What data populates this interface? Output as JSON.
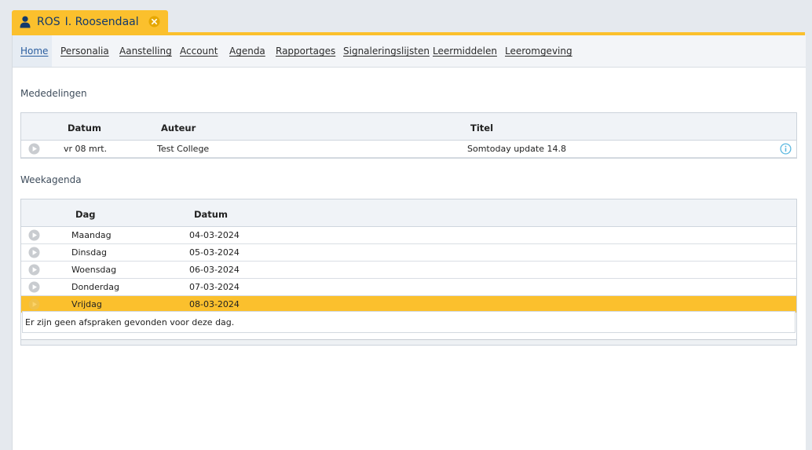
{
  "tab": {
    "code": "ROS",
    "name": "I. Roosendaal",
    "icon": "user-icon",
    "close_icon": "close-circle-icon"
  },
  "menu": [
    {
      "label": "Home",
      "active": true
    },
    {
      "label": "Personalia"
    },
    {
      "label": "Aanstelling"
    },
    {
      "label": "Account"
    },
    {
      "label": "Agenda"
    },
    {
      "label": "Rapportages"
    },
    {
      "label": "Signaleringslijsten"
    },
    {
      "label": "Leermiddelen"
    },
    {
      "label": "Leeromgeving"
    }
  ],
  "mededelingen": {
    "title": "Mededelingen",
    "headers": {
      "datum": "Datum",
      "auteur": "Auteur",
      "titel": "Titel"
    },
    "rows": [
      {
        "datum": "vr 08 mrt.",
        "auteur": "Test College",
        "titel": "Somtoday update 14.8"
      }
    ]
  },
  "weekagenda": {
    "title": "Weekagenda",
    "headers": {
      "dag": "Dag",
      "datum": "Datum"
    },
    "rows": [
      {
        "dag": "Maandag",
        "datum": "04-03-2024"
      },
      {
        "dag": "Dinsdag",
        "datum": "05-03-2024"
      },
      {
        "dag": "Woensdag",
        "datum": "06-03-2024"
      },
      {
        "dag": "Donderdag",
        "datum": "07-03-2024"
      },
      {
        "dag": "Vrijdag",
        "datum": "08-03-2024",
        "selected": true
      }
    ],
    "empty_message": "Er zijn geen afspraken gevonden voor deze dag."
  },
  "colors": {
    "accent": "#fbc02d",
    "link": "#2a5d9f",
    "title": "#143a6b"
  }
}
